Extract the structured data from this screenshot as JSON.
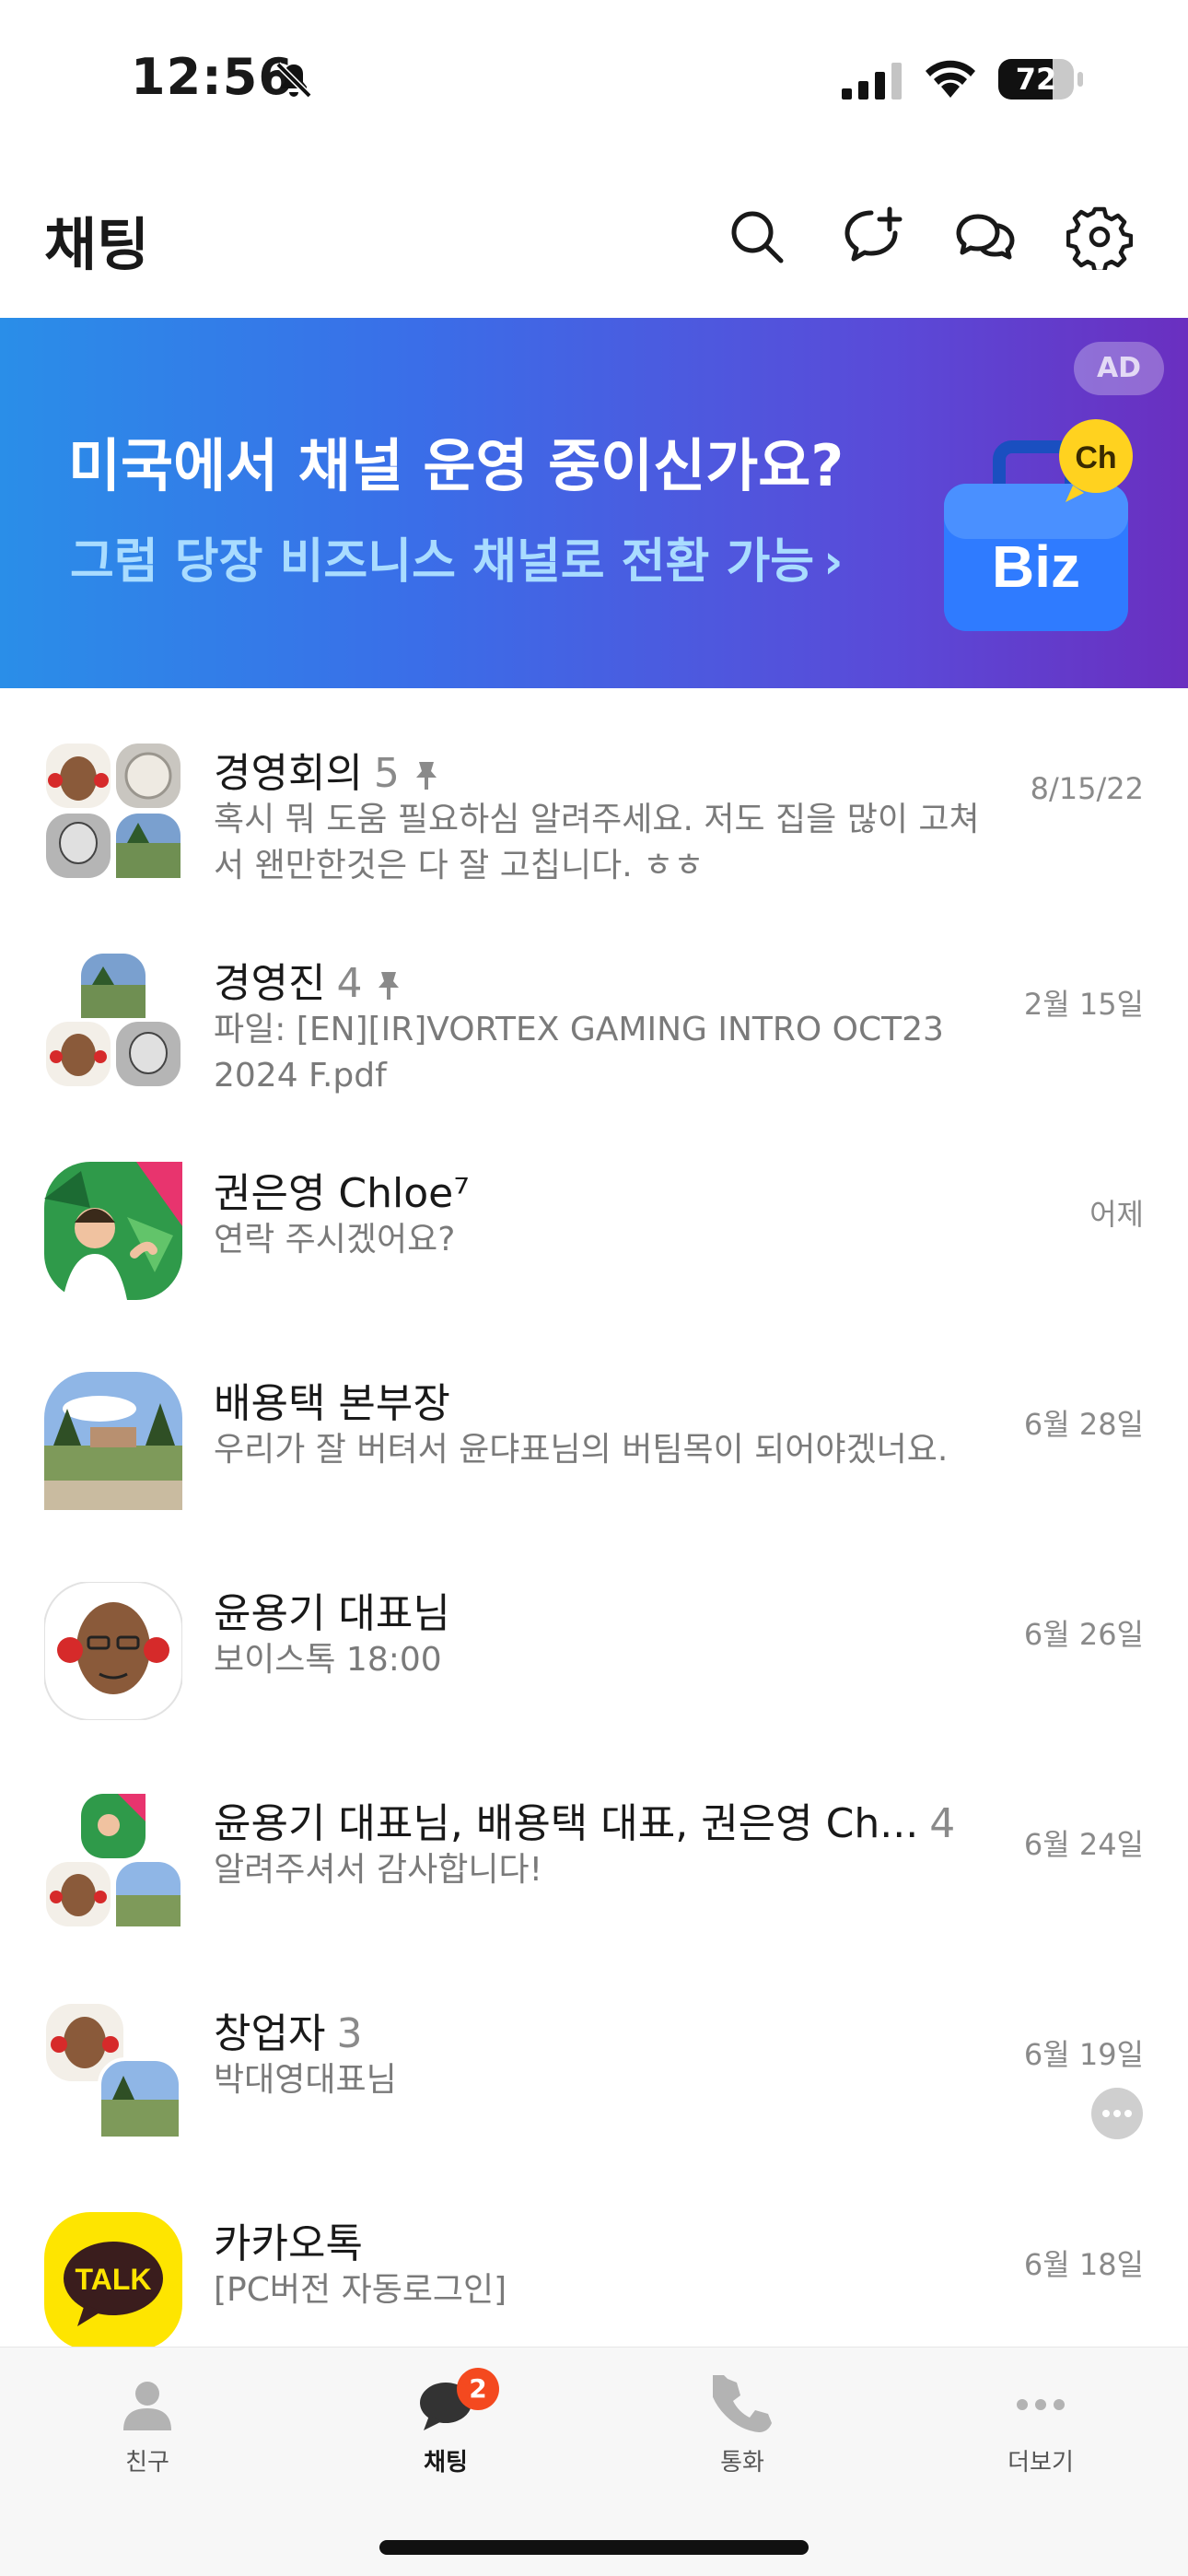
{
  "status_bar": {
    "time": "12:56",
    "battery_level": 72,
    "battery_text": "72"
  },
  "header": {
    "title": "채팅"
  },
  "ad": {
    "headline": "미국에서 채널 운영 중이신가요?",
    "subline": "그럼 당장 비즈니스 채널로 전환 가능",
    "badge": "AD",
    "ch_label": "Ch",
    "biz_label": "Biz"
  },
  "chats": [
    {
      "name": "경영회의",
      "count": "5",
      "pinned": true,
      "preview": "혹시 뭐 도움 필요하심 알려주세요. 저도 집을 많이 고쳐서 왠만한것은 다 잘 고칩니다. ㅎㅎ",
      "date": "8/15/22"
    },
    {
      "name": "경영진",
      "count": "4",
      "pinned": true,
      "preview": "파일: [EN][IR]VORTEX GAMING INTRO OCT23 2024 F.pdf",
      "date": "2월 15일"
    },
    {
      "name": "권은영 Chloe⁷",
      "count": "",
      "pinned": false,
      "preview": "연락 주시겠어요?",
      "date": "어제"
    },
    {
      "name": "배용택 본부장",
      "count": "",
      "pinned": false,
      "preview": "우리가 잘 버텨서 윤댜표님의 버팀목이 되어야겠너요.",
      "date": "6월 28일"
    },
    {
      "name": "윤용기 대표님",
      "count": "",
      "pinned": false,
      "preview": "보이스톡 18:00",
      "date": "6월 26일"
    },
    {
      "name": "윤용기 대표님, 배용택 대표, 권은영 Ch...",
      "count": "4",
      "pinned": false,
      "preview": "알려주셔서 감사합니다!",
      "date": "6월 24일"
    },
    {
      "name": "창업자",
      "count": "3",
      "pinned": false,
      "preview": "박대영대표님",
      "date": "6월 19일"
    },
    {
      "name": "카카오톡",
      "count": "",
      "pinned": false,
      "preview": "[PC버전 자동로그인]",
      "date": "6월 18일",
      "logo_text": "TALK"
    }
  ],
  "tabs": [
    {
      "label": "친구",
      "icon": "person-icon"
    },
    {
      "label": "채팅",
      "icon": "chat-bubble-icon",
      "badge": "2",
      "active": true
    },
    {
      "label": "통화",
      "icon": "phone-icon"
    },
    {
      "label": "더보기",
      "icon": "more-dots-icon"
    }
  ],
  "colors": {
    "accent_badge": "#f4491f",
    "kakao_yellow": "#fee500"
  }
}
